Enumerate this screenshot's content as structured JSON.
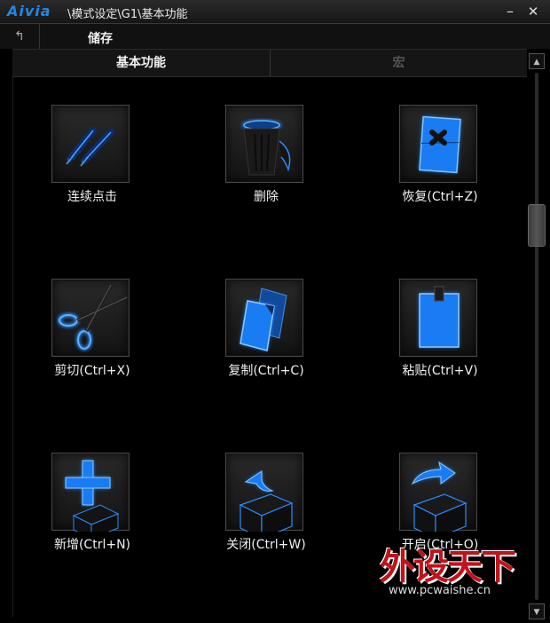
{
  "window": {
    "logo": "Aivia",
    "title": "\\模式设定\\G1\\基本功能",
    "minimize": "–",
    "close": "✕"
  },
  "toolbar": {
    "back_icon": "↰",
    "save_label": "储存"
  },
  "tabs": [
    {
      "label": "基本功能",
      "active": true
    },
    {
      "label": "宏",
      "active": false
    }
  ],
  "functions": [
    {
      "label": "连续点击",
      "icon": "pen-icon"
    },
    {
      "label": "删除",
      "icon": "trash-icon"
    },
    {
      "label": "恢复(Ctrl+Z)",
      "icon": "undo-icon"
    },
    {
      "label": "剪切(Ctrl+X)",
      "icon": "scissors-icon"
    },
    {
      "label": "复制(Ctrl+C)",
      "icon": "copy-icon"
    },
    {
      "label": "粘贴(Ctrl+V)",
      "icon": "paste-icon"
    },
    {
      "label": "新增(Ctrl+N)",
      "icon": "new-icon"
    },
    {
      "label": "关闭(Ctrl+W)",
      "icon": "close-box-icon"
    },
    {
      "label": "开启(Ctrl+O)",
      "icon": "open-box-icon"
    }
  ],
  "scrollbar": {
    "up": "▲",
    "down": "▼"
  },
  "watermark": {
    "logo": "外设天下",
    "url": "www.pcwaishe.cn"
  },
  "colors": {
    "accent": "#1e88e5",
    "glow": "#2a8cff",
    "watermark": "#c2121a"
  }
}
